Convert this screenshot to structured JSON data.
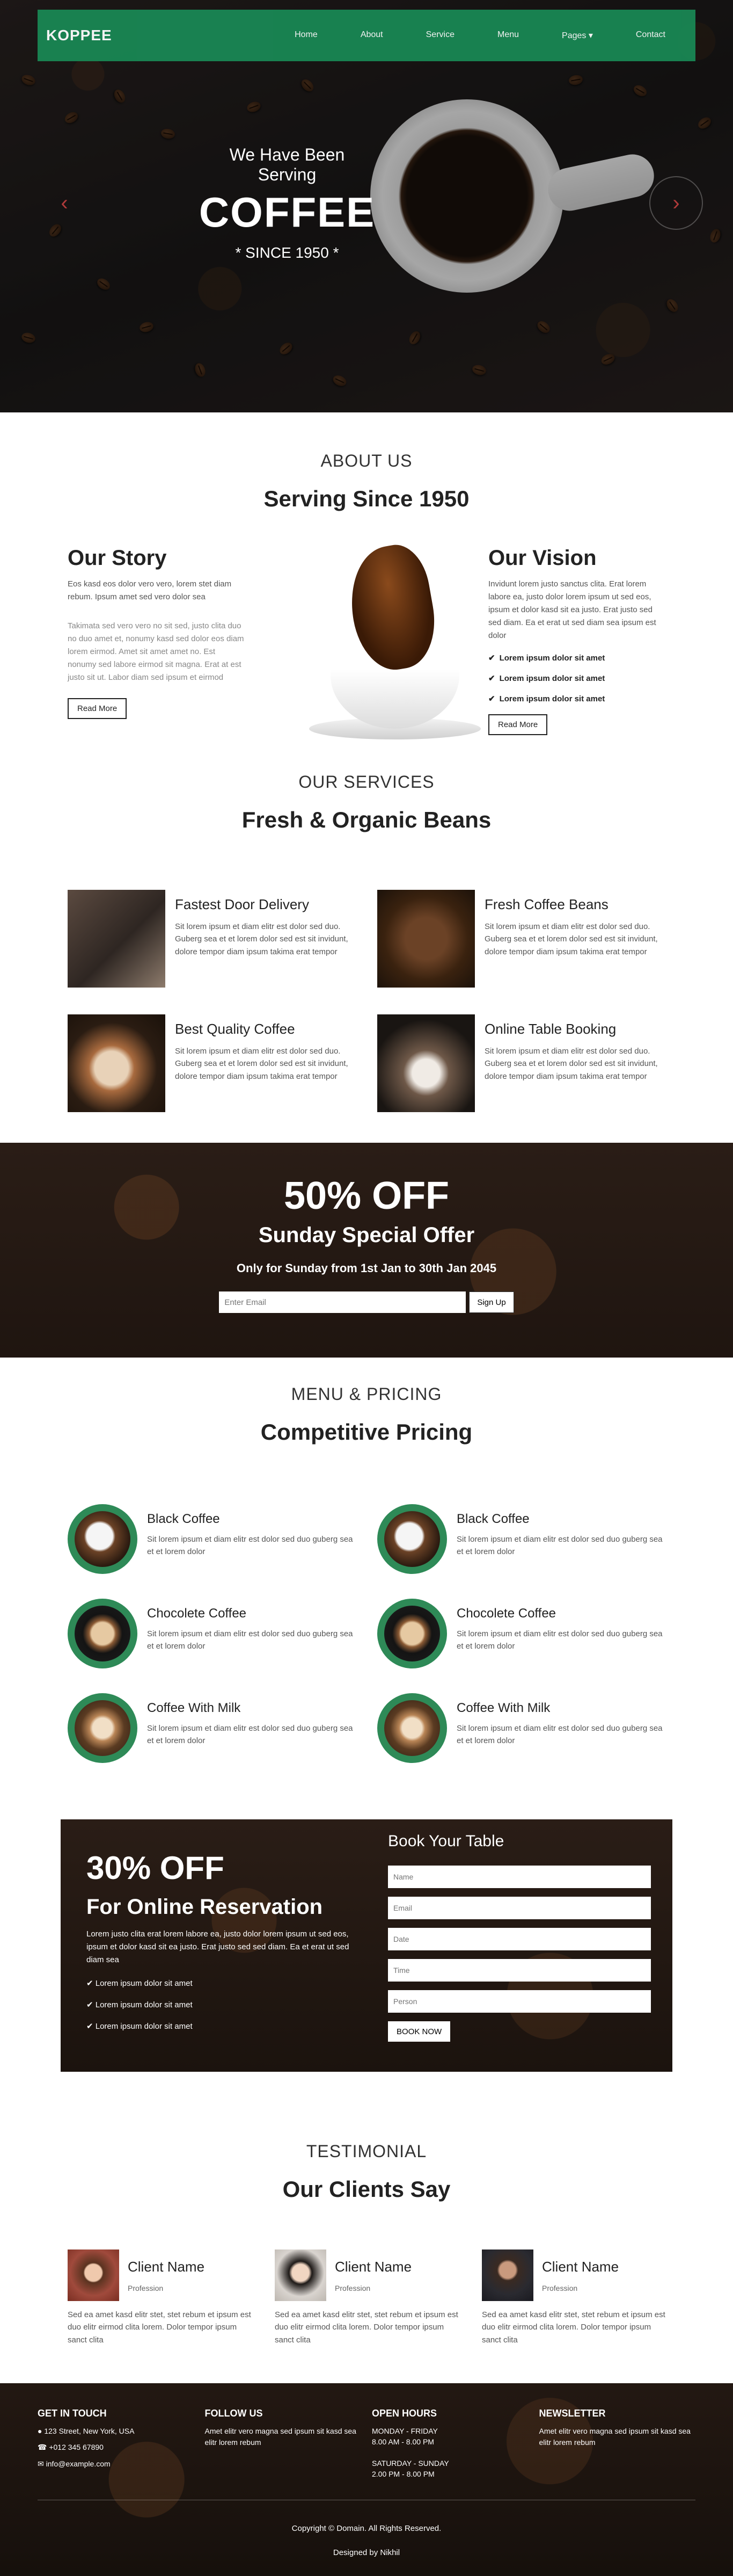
{
  "nav": {
    "brand": "KOPPEE",
    "items": [
      {
        "label": "Home"
      },
      {
        "label": "About"
      },
      {
        "label": "Service"
      },
      {
        "label": "Menu"
      },
      {
        "label": "Pages ▾"
      },
      {
        "label": "Contact"
      }
    ]
  },
  "hero": {
    "line1": "We Have Been Serving",
    "line2": "COFFEE",
    "line3": "* SINCE 1950 *",
    "prev_icon": "‹",
    "next_icon": "›"
  },
  "about": {
    "kicker": "ABOUT US",
    "title": "Serving Since 1950",
    "story_title": "Our Story",
    "story_p1": "Eos kasd eos dolor vero vero, lorem stet diam rebum. Ipsum amet sed vero dolor sea",
    "story_p2": "Takimata sed vero vero no sit sed, justo clita duo no duo amet et, nonumy kasd sed dolor eos diam lorem eirmod. Amet sit amet amet no. Est nonumy sed labore eirmod sit magna. Erat at est justo sit ut. Labor diam sed ipsum et eirmod",
    "story_btn": "Read More",
    "vision_title": "Our Vision",
    "vision_p": "Invidunt lorem justo sanctus clita. Erat lorem labore ea, justo dolor lorem ipsum ut sed eos, ipsum et dolor kasd sit ea justo. Erat justo sed sed diam. Ea et erat ut sed diam sea ipsum est dolor",
    "vision_list": [
      "Lorem ipsum dolor sit amet",
      "Lorem ipsum dolor sit amet",
      "Lorem ipsum dolor sit amet"
    ],
    "vision_btn": "Read More"
  },
  "services": {
    "kicker": "OUR SERVICES",
    "title": "Fresh & Organic Beans",
    "items": [
      {
        "title": "Fastest Door Delivery",
        "text": "Sit lorem ipsum et diam elitr est dolor sed duo. Guberg sea et et lorem dolor sed est sit invidunt, dolore tempor diam ipsum takima erat tempor"
      },
      {
        "title": "Fresh Coffee Beans",
        "text": "Sit lorem ipsum et diam elitr est dolor sed duo. Guberg sea et et lorem dolor sed est sit invidunt, dolore tempor diam ipsum takima erat tempor"
      },
      {
        "title": "Best Quality Coffee",
        "text": "Sit lorem ipsum et diam elitr est dolor sed duo. Guberg sea et et lorem dolor sed est sit invidunt, dolore tempor diam ipsum takima erat tempor"
      },
      {
        "title": "Online Table Booking",
        "text": "Sit lorem ipsum et diam elitr est dolor sed duo. Guberg sea et et lorem dolor sed est sit invidunt, dolore tempor diam ipsum takima erat tempor"
      }
    ]
  },
  "offer": {
    "pct": "50% OFF",
    "sub": "Sunday Special Offer",
    "dates": "Only for Sunday from 1st Jan to 30th Jan 2045",
    "email_placeholder": "Enter Email",
    "btn": "Sign Up"
  },
  "menu": {
    "kicker": "MENU & PRICING",
    "title": "Competitive Pricing",
    "items": [
      {
        "name": "Black Coffee",
        "text": "Sit lorem ipsum et diam elitr est dolor sed duo guberg sea et et lorem dolor"
      },
      {
        "name": "Black Coffee",
        "text": "Sit lorem ipsum et diam elitr est dolor sed duo guberg sea et et lorem dolor"
      },
      {
        "name": "Chocolete Coffee",
        "text": "Sit lorem ipsum et diam elitr est dolor sed duo guberg sea et et lorem dolor"
      },
      {
        "name": "Chocolete Coffee",
        "text": "Sit lorem ipsum et diam elitr est dolor sed duo guberg sea et et lorem dolor"
      },
      {
        "name": "Coffee With Milk",
        "text": "Sit lorem ipsum et diam elitr est dolor sed duo guberg sea et et lorem dolor"
      },
      {
        "name": "Coffee With Milk",
        "text": "Sit lorem ipsum et diam elitr est dolor sed duo guberg sea et et lorem dolor"
      }
    ]
  },
  "reserve": {
    "pct": "30% OFF",
    "sub": "For Online Reservation",
    "text": "Lorem justo clita erat lorem labore ea, justo dolor lorem ipsum ut sed eos, ipsum et dolor kasd sit ea justo. Erat justo sed sed diam. Ea et erat ut sed diam sea",
    "list": [
      "Lorem ipsum dolor sit amet",
      "Lorem ipsum dolor sit amet",
      "Lorem ipsum dolor sit amet"
    ],
    "form_title": "Book Your Table",
    "ph_name": "Name",
    "ph_email": "Email",
    "ph_date": "Date",
    "ph_time": "Time",
    "ph_person": "Person",
    "btn": "BOOK NOW"
  },
  "testimonial": {
    "kicker": "TESTIMONIAL",
    "title": "Our Clients Say",
    "items": [
      {
        "name": "Client Name",
        "prof": "Profession",
        "text": "Sed ea amet kasd elitr stet, stet rebum et ipsum est duo elitr eirmod clita lorem. Dolor tempor ipsum sanct clita"
      },
      {
        "name": "Client Name",
        "prof": "Profession",
        "text": "Sed ea amet kasd elitr stet, stet rebum et ipsum est duo elitr eirmod clita lorem. Dolor tempor ipsum sanct clita"
      },
      {
        "name": "Client Name",
        "prof": "Profession",
        "text": "Sed ea amet kasd elitr stet, stet rebum et ipsum est duo elitr eirmod clita lorem. Dolor tempor ipsum sanct clita"
      }
    ]
  },
  "footer": {
    "touch_title": "GET IN TOUCH",
    "address": "● 123 Street, New York, USA",
    "phone": "☎ +012 345 67890",
    "email": "✉ info@example.com",
    "follow_title": "FOLLOW US",
    "follow_text": "Amet elitr vero magna sed ipsum sit kasd sea elitr lorem rebum",
    "hours_title": "OPEN HOURS",
    "hours_l1": "MONDAY - FRIDAY",
    "hours_l2": "8.00 AM - 8.00 PM",
    "hours_l3": "SATURDAY - SUNDAY",
    "hours_l4": "2.00 PM - 8.00 PM",
    "news_title": "NEWSLETTER",
    "news_text": "Amet elitr vero magna sed ipsum sit kasd sea elitr lorem rebum",
    "copyright": "Copyright © Domain. All Rights Reserved.",
    "designed": "Designed by Nikhil"
  }
}
